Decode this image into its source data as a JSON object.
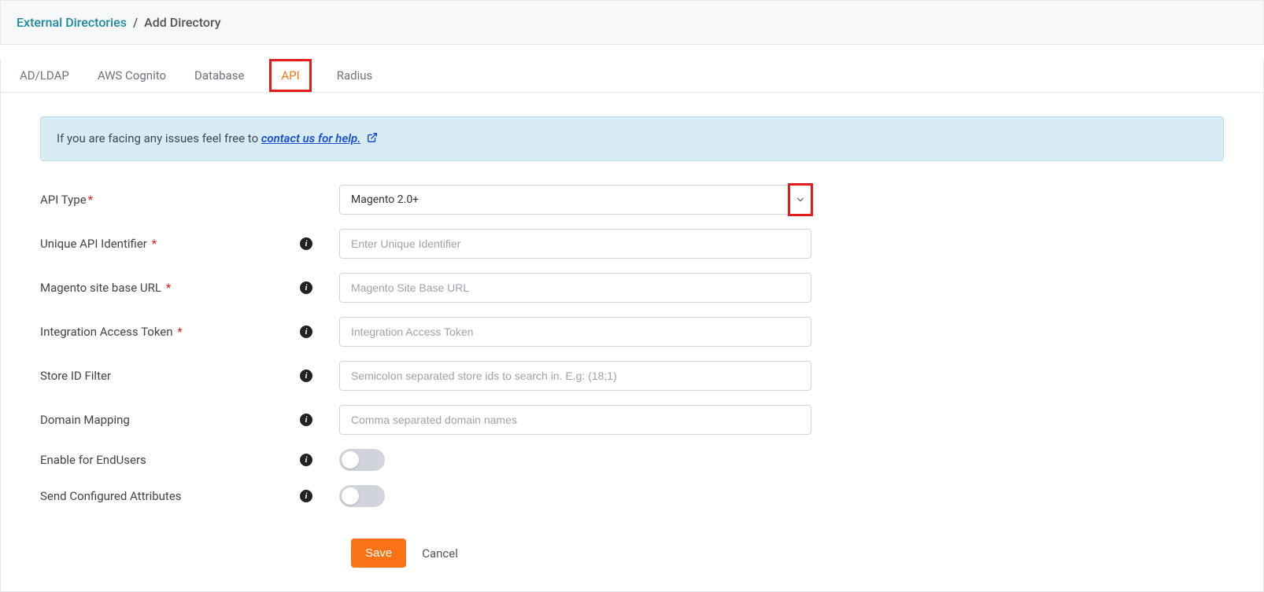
{
  "breadcrumb": {
    "parent": "External Directories",
    "separator": "/",
    "current": "Add Directory"
  },
  "tabs": [
    {
      "label": "AD/LDAP",
      "active": false
    },
    {
      "label": "AWS Cognito",
      "active": false
    },
    {
      "label": "Database",
      "active": false
    },
    {
      "label": "API",
      "active": true
    },
    {
      "label": "Radius",
      "active": false
    }
  ],
  "banner": {
    "text": "If you are facing any issues feel free to ",
    "link_text": "contact us for help."
  },
  "form": {
    "api_type": {
      "label": "API Type",
      "required": true,
      "value": "Magento 2.0+"
    },
    "unique_identifier": {
      "label": "Unique API Identifier",
      "required": true,
      "placeholder": "Enter Unique Identifier",
      "value": ""
    },
    "base_url": {
      "label": "Magento site base URL",
      "required": true,
      "placeholder": "Magento Site Base URL",
      "value": ""
    },
    "access_token": {
      "label": "Integration Access Token",
      "required": true,
      "placeholder": "Integration Access Token",
      "value": ""
    },
    "store_id": {
      "label": "Store ID Filter",
      "required": false,
      "placeholder": "Semicolon separated store ids to search in. E.g: (18;1)",
      "value": ""
    },
    "domain_mapping": {
      "label": "Domain Mapping",
      "required": false,
      "placeholder": "Comma separated domain names",
      "value": ""
    },
    "enable_endusers": {
      "label": "Enable for EndUsers",
      "value": false
    },
    "send_attributes": {
      "label": "Send Configured Attributes",
      "value": false
    }
  },
  "buttons": {
    "save": "Save",
    "cancel": "Cancel"
  }
}
